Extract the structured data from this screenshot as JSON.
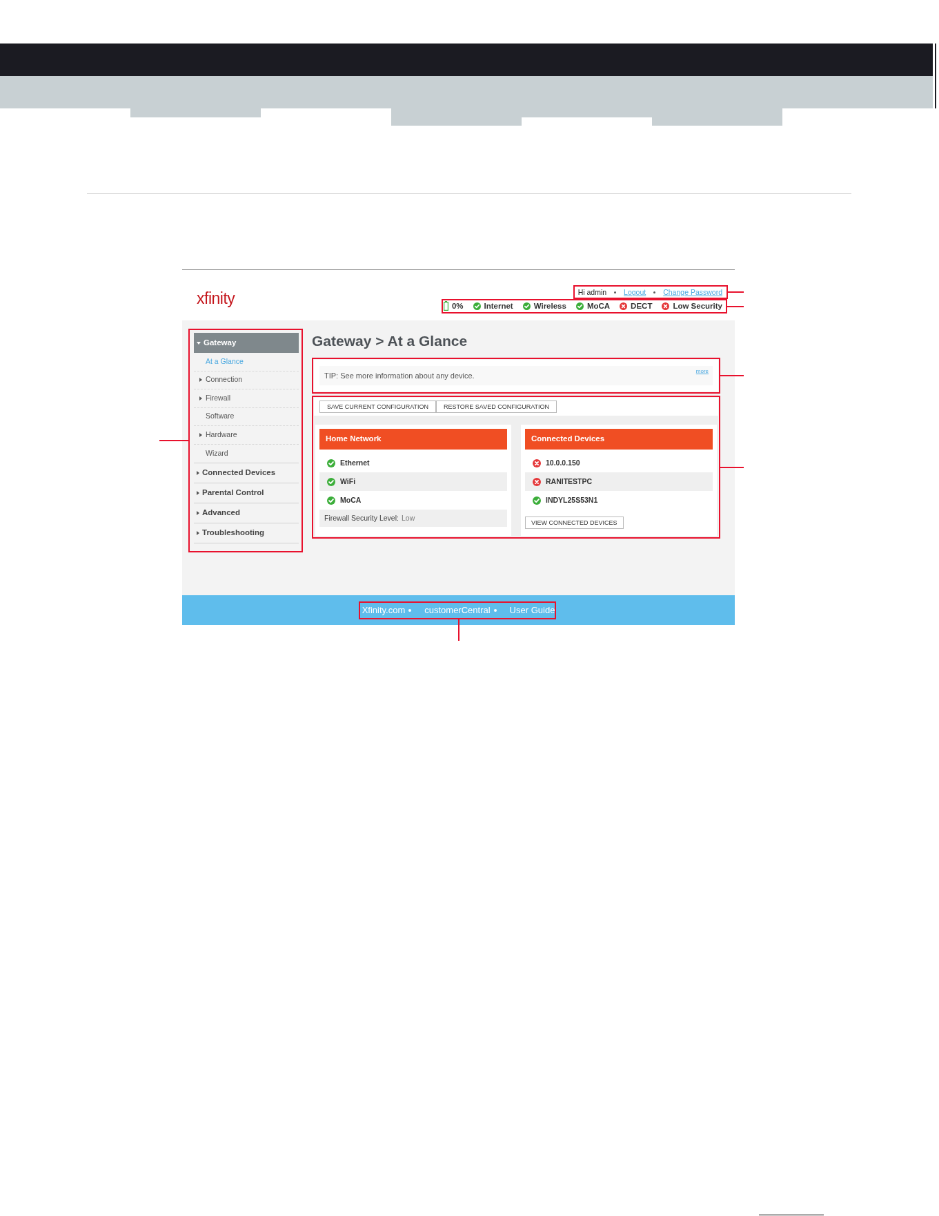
{
  "header": {
    "logo": "xfinity",
    "user_bar": {
      "greeting": "Hi admin",
      "links": [
        "Logout",
        "Change Password"
      ]
    },
    "status_items": [
      {
        "kind": "battery",
        "label": "0%"
      },
      {
        "kind": "status",
        "label": "Internet",
        "ok": true
      },
      {
        "kind": "status",
        "label": "Wireless",
        "ok": true
      },
      {
        "kind": "status",
        "label": "MoCA",
        "ok": true
      },
      {
        "kind": "status",
        "label": "DECT",
        "ok": false
      },
      {
        "kind": "status",
        "label": "Low Security",
        "ok": false
      }
    ]
  },
  "sidebar": {
    "items": [
      {
        "label": "Gateway",
        "selected": true,
        "expanded": true,
        "children": [
          {
            "label": "At a Glance",
            "selected": true
          },
          {
            "label": "Connection",
            "selected": false,
            "expanded": false
          },
          {
            "label": "Firewall",
            "selected": false,
            "expanded": false
          },
          {
            "label": "Software",
            "selected": false
          },
          {
            "label": "Hardware",
            "selected": false,
            "expanded": false
          },
          {
            "label": "Wizard",
            "selected": false
          }
        ]
      },
      {
        "label": "Connected Devices",
        "selected": false,
        "expanded": false
      },
      {
        "label": "Parental Control",
        "selected": false,
        "expanded": false
      },
      {
        "label": "Advanced",
        "selected": false,
        "expanded": false
      },
      {
        "label": "Troubleshooting",
        "selected": false,
        "expanded": false
      }
    ]
  },
  "main": {
    "title": "Gateway > At a Glance",
    "tip": {
      "text": "TIP: See more information about any device.",
      "link": "more"
    },
    "buttons": [
      "SAVE CURRENT CONFIGURATION",
      "RESTORE SAVED CONFIGURATION"
    ],
    "cards": [
      {
        "kind": "network",
        "title": "Home Network",
        "items": [
          {
            "label": "Ethernet",
            "ok": true
          },
          {
            "label": "WiFi",
            "ok": true
          },
          {
            "label": "MoCA",
            "ok": true
          }
        ],
        "footer_label": "Firewall Security Level:",
        "footer_value": "Low"
      },
      {
        "kind": "devices",
        "title": "Connected Devices",
        "items": [
          {
            "label": "10.0.0.150",
            "ok": false
          },
          {
            "label": "RANITESTPC",
            "ok": false
          },
          {
            "label": "INDYL25S53N1",
            "ok": true
          }
        ],
        "button": "VIEW CONNECTED DEVICES"
      }
    ]
  },
  "footer": {
    "links": [
      "Xfinity.com",
      "customerCentral",
      "User Guide"
    ]
  }
}
